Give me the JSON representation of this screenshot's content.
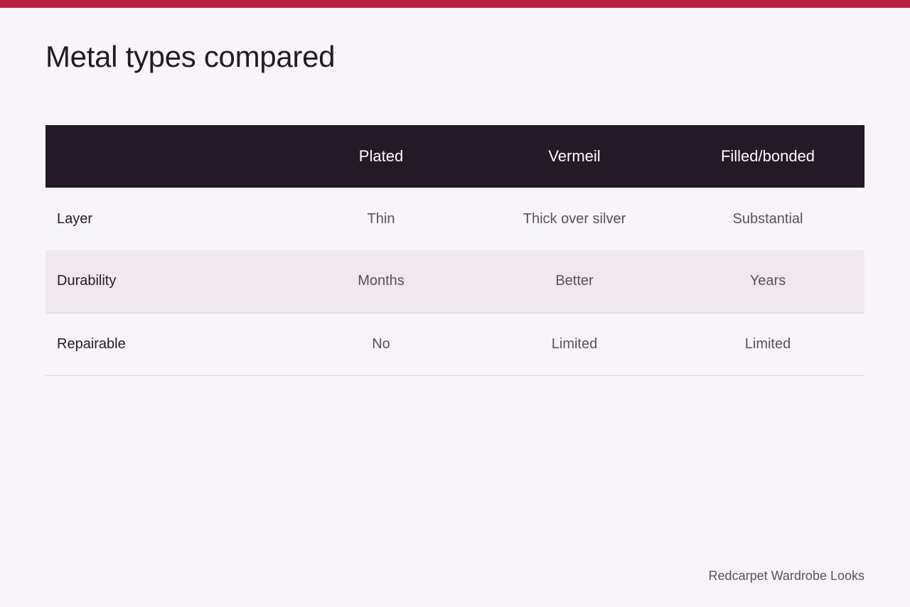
{
  "colors": {
    "accent_bar": "#b8203e",
    "header_bg": "#241a27",
    "page_bg": "#f7f5f8",
    "shaded_row_bg": "#efe8ee"
  },
  "page": {
    "title": "Metal types compared"
  },
  "table": {
    "columns": [
      "",
      "Plated",
      "Vermeil",
      "Filled/bonded"
    ],
    "rows": [
      {
        "label": "Layer",
        "cells": [
          "Thin",
          "Thick over silver",
          "Substantial"
        ]
      },
      {
        "label": "Durability",
        "cells": [
          "Months",
          "Better",
          "Years"
        ]
      },
      {
        "label": "Repairable",
        "cells": [
          "No",
          "Limited",
          "Limited"
        ]
      }
    ]
  },
  "footer": {
    "brand": "Redcarpet Wardrobe Looks"
  }
}
